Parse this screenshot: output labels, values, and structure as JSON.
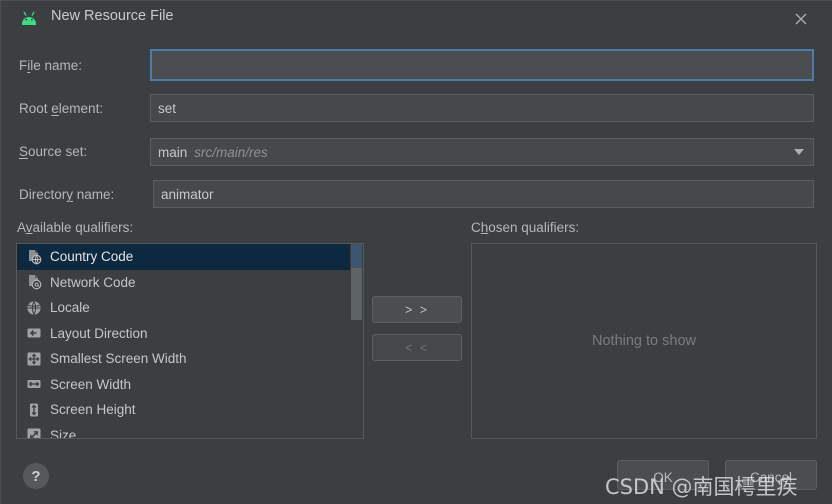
{
  "window": {
    "title": "New Resource File",
    "app_icon": "android-icon",
    "close_icon": "close-icon",
    "accent_focus_color": "#4e7ca8",
    "background_color": "#3c3f41",
    "android_green": "#3ddc84"
  },
  "form": {
    "file_name": {
      "label_pre": "F",
      "label_mnemonic": "i",
      "label_post": "le name:",
      "value": "",
      "placeholder": "",
      "focused": true
    },
    "root_element": {
      "label_pre": "Root ",
      "label_mnemonic": "e",
      "label_post": "lement:",
      "value": "set"
    },
    "source_set": {
      "label_pre": "",
      "label_mnemonic": "S",
      "label_post": "ource set:",
      "value": "main",
      "path_hint": "src/main/res",
      "dropdown_icon": "chevron-down-icon"
    },
    "directory_name": {
      "label_pre": "Director",
      "label_mnemonic": "y",
      "label_post": " name:",
      "value": "animator"
    }
  },
  "qualifiers": {
    "available_label_pre": "A",
    "available_label_mnemonic": "v",
    "available_label_post": "ailable qualifiers:",
    "chosen_label_pre": "C",
    "chosen_label_mnemonic": "h",
    "chosen_label_post": "osen qualifiers:",
    "available_items": [
      {
        "label": "Country Code",
        "icon": "file-globe-icon",
        "selected": true
      },
      {
        "label": "Network Code",
        "icon": "file-at-icon",
        "selected": false
      },
      {
        "label": "Locale",
        "icon": "globe-icon",
        "selected": false
      },
      {
        "label": "Layout Direction",
        "icon": "arrow-left-icon",
        "selected": false
      },
      {
        "label": "Smallest Screen Width",
        "icon": "arrows-four-way-icon",
        "selected": false
      },
      {
        "label": "Screen Width",
        "icon": "arrows-horizontal-icon",
        "selected": false
      },
      {
        "label": "Screen Height",
        "icon": "arrows-vertical-icon",
        "selected": false
      },
      {
        "label": "Size",
        "icon": "arrow-diagonal-icon",
        "selected": false
      }
    ],
    "chosen_empty_text": "Nothing to show",
    "add_button_label": "> >",
    "remove_button_label": "< <",
    "add_enabled": true,
    "remove_enabled": false
  },
  "footer": {
    "help_label": "?",
    "ok_label": "OK",
    "cancel_label": "Cancel"
  },
  "overlay": {
    "watermark": "CSDN @南国樗里疾"
  }
}
